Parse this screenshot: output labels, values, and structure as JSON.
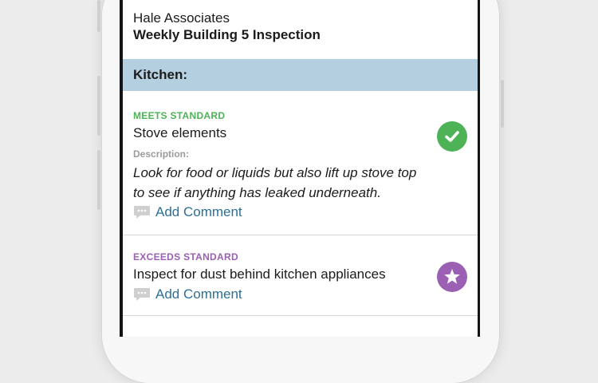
{
  "header": {
    "company": "Hale Associates",
    "title": "Weekly Building 5 Inspection"
  },
  "section": {
    "title": "Kitchen:"
  },
  "items": [
    {
      "status": "MEETS STANDARD",
      "title": "Stove elements",
      "description_label": "Description:",
      "description": "Look for food or liquids but also lift up stove top to see if anything has leaked underneath.",
      "comment_label": "Add Comment",
      "badge_icon": "checkmark-icon",
      "status_color": "#4db356"
    },
    {
      "status": "EXCEEDS STANDARD",
      "title": "Inspect for dust behind kitchen appliances",
      "comment_label": "Add Comment",
      "badge_icon": "star-icon",
      "status_color": "#9b60b3"
    }
  ]
}
